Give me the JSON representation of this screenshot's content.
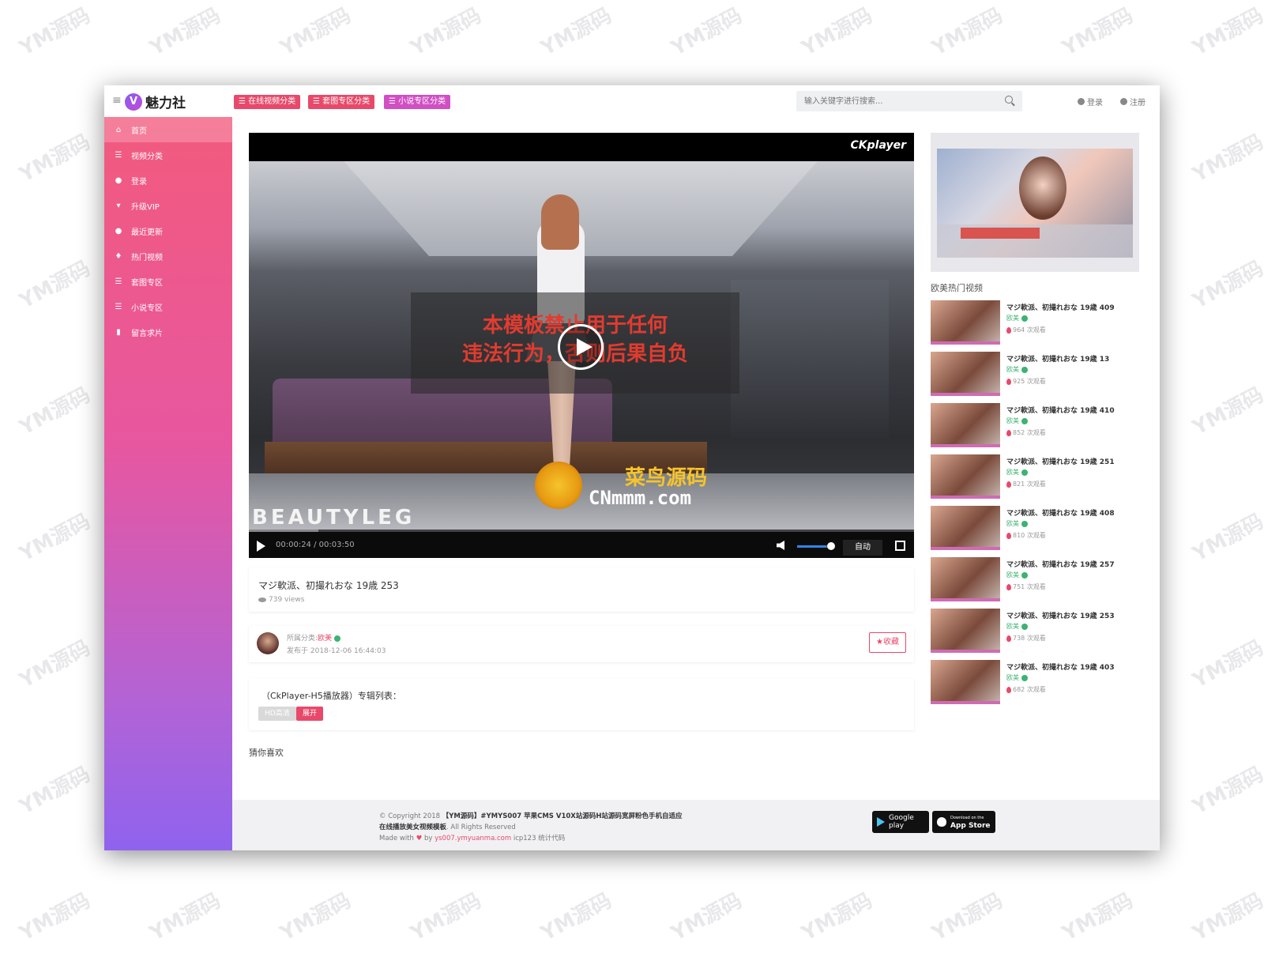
{
  "header": {
    "logo_badge": "V",
    "logo_text": "魅力社",
    "categories": [
      {
        "label": "☰ 在线视频分类",
        "color": "#e8496a"
      },
      {
        "label": "☰ 套图专区分类",
        "color": "#e8496a"
      },
      {
        "label": "☰ 小说专区分类",
        "color": "#d04fc3"
      }
    ],
    "search_placeholder": "输入关键字进行搜索...",
    "login": "登录",
    "register": "注册"
  },
  "sidebar": {
    "items": [
      {
        "label": "首页",
        "icon": "home-icon",
        "active": true
      },
      {
        "label": "视频分类",
        "icon": "list-icon"
      },
      {
        "label": "登录",
        "icon": "user-circle-icon"
      },
      {
        "label": "升级VIP",
        "icon": "cart-icon"
      },
      {
        "label": "最近更新",
        "icon": "user-icon"
      },
      {
        "label": "热门视频",
        "icon": "fire-icon"
      },
      {
        "label": "套图专区",
        "icon": "list-icon"
      },
      {
        "label": "小说专区",
        "icon": "list-icon"
      },
      {
        "label": "留言求片",
        "icon": "clipboard-icon"
      }
    ]
  },
  "player": {
    "brand": "CKplayer",
    "warning_line1": "本模板禁止用于任何",
    "warning_line2": "违法行为，否则后果自负",
    "watermark_cn": "菜鸟源码",
    "watermark_en": "CNmmm.com",
    "beautyleg": "BEAUTYLEG",
    "time": "00:00:24 / 00:03:50",
    "progress": 0.104,
    "volume": 0.85,
    "quality": "自动"
  },
  "video": {
    "title": "マジ軟派、初撮れおな 19歳 253",
    "views": "739 views"
  },
  "meta": {
    "category_label": "所属分类:",
    "category": "欧美",
    "published": "发布于 2018-12-06 16:44:03",
    "favorite": "★收藏"
  },
  "album": {
    "title": "（CkPlayer-H5播放器）专辑列表：",
    "hd": "HD高清",
    "expand": "展开"
  },
  "guess_title": "猜你喜欢",
  "hot": {
    "title": "欧美热门视频",
    "items": [
      {
        "title": "マジ軟派、初撮れおな 19歳 409",
        "tag": "欧美",
        "views": "964 次观看"
      },
      {
        "title": "マジ軟派、初撮れおな 19歳 13",
        "tag": "欧美",
        "views": "925 次观看"
      },
      {
        "title": "マジ軟派、初撮れおな 19歳 410",
        "tag": "欧美",
        "views": "852 次观看"
      },
      {
        "title": "マジ軟派、初撮れおな 19歳 251",
        "tag": "欧美",
        "views": "821 次观看"
      },
      {
        "title": "マジ軟派、初撮れおな 19歳 408",
        "tag": "欧美",
        "views": "810 次观看"
      },
      {
        "title": "マジ軟派、初撮れおな 19歳 257",
        "tag": "欧美",
        "views": "751 次观看"
      },
      {
        "title": "マジ軟派、初撮れおな 19歳 253",
        "tag": "欧美",
        "views": "738 次观看"
      },
      {
        "title": "マジ軟派、初撮れおな 19歳 403",
        "tag": "欧美",
        "views": "682 次观看"
      }
    ]
  },
  "footer": {
    "copyright_prefix": "© Copyright 2018",
    "copyright_bold": "【YM源码】#YMYS007 苹果CMS V10X站源码H站源码宽屏粉色手机自适应",
    "line2_bold": "在线播放美女视频模板",
    "line2_rest": ". All Rights Reserved",
    "made_with": "Made with",
    "by": "by",
    "link": "ys007.ymyuanma.com",
    "icp": "icp123 统计代码",
    "google_play": "Google play",
    "app_store_small": "Download on the",
    "app_store": "App Store"
  },
  "watermark": "YM源码"
}
